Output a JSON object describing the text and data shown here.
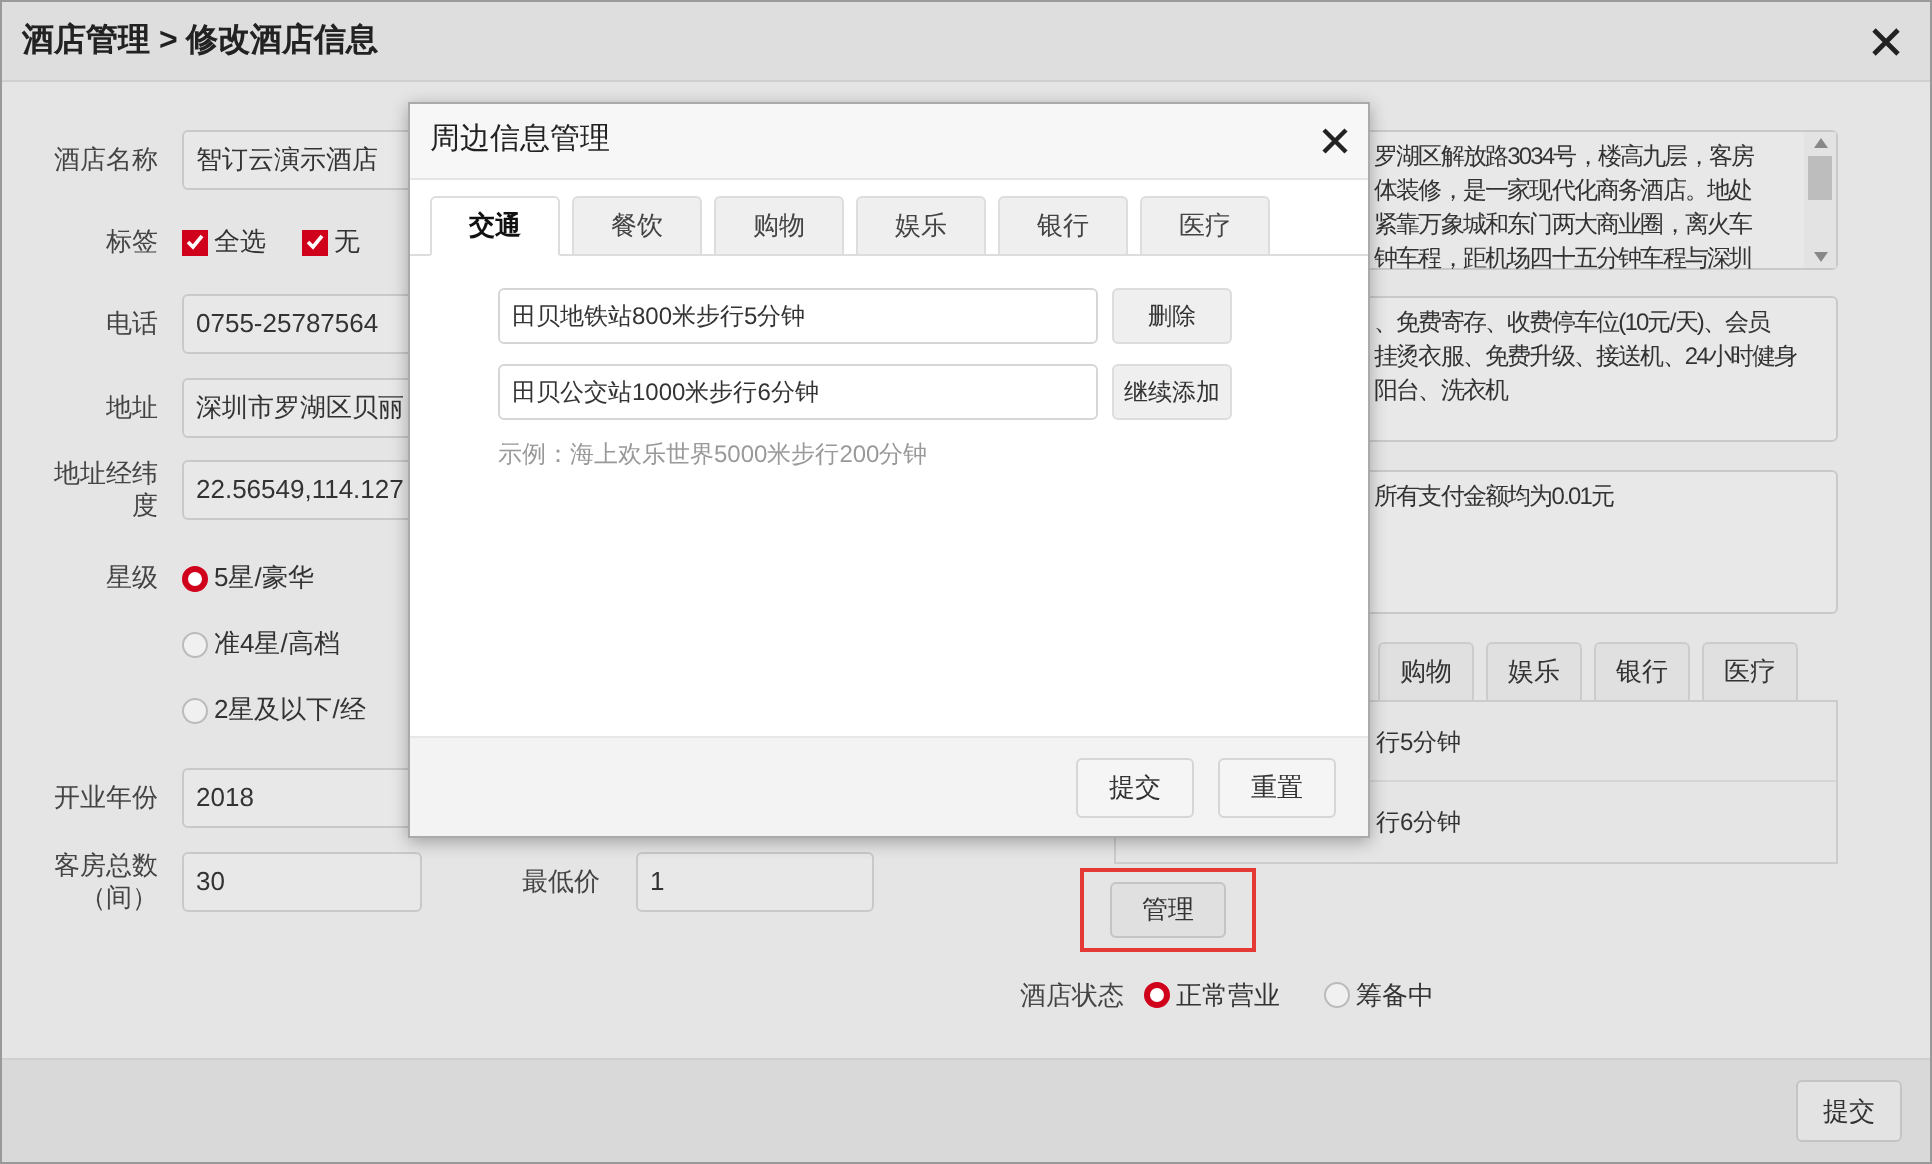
{
  "window": {
    "title": "酒店管理 > 修改酒店信息"
  },
  "form": {
    "name": {
      "label": "酒店名称",
      "value": "智订云演示酒店"
    },
    "tags": {
      "label": "标签",
      "options": [
        {
          "label": "全选",
          "checked": true
        },
        {
          "label": "无",
          "checked": true
        }
      ]
    },
    "phone": {
      "label": "电话",
      "value": "0755-25787564"
    },
    "address": {
      "label": "地址",
      "value": "深圳市罗湖区贝丽"
    },
    "coords": {
      "label": "地址经纬度",
      "value": "22.56549,114.127"
    },
    "star": {
      "label": "星级",
      "options": [
        {
          "label": "5星/豪华",
          "selected": true
        },
        {
          "label": "准4星/高档",
          "selected": false
        },
        {
          "label": "2星及以下/经",
          "selected": false
        }
      ]
    },
    "year": {
      "label": "开业年份",
      "value": "2018"
    },
    "rooms": {
      "label": "客房总数（间）",
      "value": "30"
    },
    "min_price": {
      "label": "最低价",
      "value": "1"
    },
    "description": [
      "罗湖区解放路3034号，楼高九层，客房",
      "体装修，是一家现代化商务酒店。地处",
      "紧靠万象城和东门两大商业圈，离火车",
      "钟车程，距机场四十五分钟车程与深圳"
    ],
    "facilities": [
      "、免费寄存、收费停车位(10元/天)、会员",
      "挂烫衣服、免费升级、接送机、24小时健身",
      "阳台、洗衣机"
    ],
    "notice": [
      "所有支付金额均为0.01元"
    ],
    "nearby_tabs": [
      "购物",
      "娱乐",
      "银行",
      "医疗"
    ],
    "nearby_rows": [
      "行5分钟",
      "行6分钟"
    ],
    "manage_button": "管理",
    "status": {
      "label": "酒店状态",
      "options": [
        {
          "label": "正常营业",
          "selected": true
        },
        {
          "label": "筹备中",
          "selected": false
        }
      ]
    }
  },
  "footer": {
    "submit": "提交"
  },
  "dialog": {
    "title": "周边信息管理",
    "tabs": [
      {
        "label": "交通",
        "selected": true
      },
      {
        "label": "餐饮",
        "selected": false
      },
      {
        "label": "购物",
        "selected": false
      },
      {
        "label": "娱乐",
        "selected": false
      },
      {
        "label": "银行",
        "selected": false
      },
      {
        "label": "医疗",
        "selected": false
      }
    ],
    "entries": [
      {
        "value": "田贝地铁站800米步行5分钟",
        "button": "删除"
      },
      {
        "value": "田贝公交站1000米步行6分钟",
        "button": "继续添加"
      }
    ],
    "hint": "示例：海上欢乐世界5000米步行200分钟",
    "buttons": [
      "提交",
      "重置"
    ]
  }
}
